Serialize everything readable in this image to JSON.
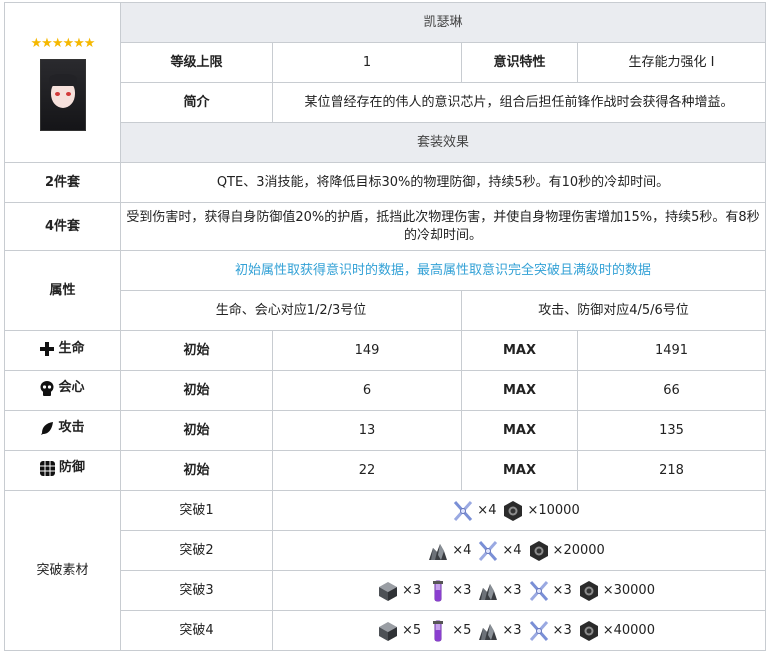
{
  "header": {
    "stars": "★★★★★★",
    "name": "凯瑟琳",
    "level_cap_label": "等级上限",
    "level_cap_value": "1",
    "trait_label": "意识特性",
    "trait_value": "生存能力强化 I",
    "intro_label": "简介",
    "intro_value": "某位曾经存在的伟人的意识芯片，组合后担任前锋作战时会获得各种增益。"
  },
  "set": {
    "title": "套装效果",
    "two_label": "2件套",
    "two_text": "QTE、3消技能，将降低目标30%的物理防御，持续5秒。有10秒的冷却时间。",
    "four_label": "4件套",
    "four_text": "受到伤害时，获得自身防御值20%的护盾，抵挡此次物理伤害，并使自身物理伤害增加15%，持续5秒。有8秒的冷却时间。"
  },
  "attributes": {
    "label": "属性",
    "note": "初始属性取获得意识时的数据，最高属性取意识完全突破且满级时的数据",
    "group_a": "生命、会心对应1/2/3号位",
    "group_b": "攻击、防御对应4/5/6号位",
    "initial_label": "初始",
    "max_label": "MAX",
    "rows": [
      {
        "name": "生命",
        "icon": "plus-icon",
        "initial": "149",
        "max": "1491"
      },
      {
        "name": "会心",
        "icon": "skull-icon",
        "initial": "6",
        "max": "66"
      },
      {
        "name": "攻击",
        "icon": "feather-icon",
        "initial": "13",
        "max": "135"
      },
      {
        "name": "防御",
        "icon": "shield-grid-icon",
        "initial": "22",
        "max": "218"
      }
    ]
  },
  "breakthrough": {
    "label": "突破素材",
    "rows": [
      {
        "name": "突破1",
        "items": [
          {
            "icon": "tweezer-icon",
            "count": "×4"
          },
          {
            "icon": "nut-icon",
            "count": "×10000"
          }
        ]
      },
      {
        "name": "突破2",
        "items": [
          {
            "icon": "ore-icon",
            "count": "×4"
          },
          {
            "icon": "tweezer-icon",
            "count": "×4"
          },
          {
            "icon": "nut-icon",
            "count": "×20000"
          }
        ]
      },
      {
        "name": "突破3",
        "items": [
          {
            "icon": "cube-icon",
            "count": "×3"
          },
          {
            "icon": "vial-icon",
            "count": "×3"
          },
          {
            "icon": "ore-icon",
            "count": "×3"
          },
          {
            "icon": "tweezer-icon",
            "count": "×3"
          },
          {
            "icon": "nut-icon",
            "count": "×30000"
          }
        ]
      },
      {
        "name": "突破4",
        "items": [
          {
            "icon": "cube-icon",
            "count": "×5"
          },
          {
            "icon": "vial-icon",
            "count": "×5"
          },
          {
            "icon": "ore-icon",
            "count": "×3"
          },
          {
            "icon": "tweezer-icon",
            "count": "×3"
          },
          {
            "icon": "nut-icon",
            "count": "×40000"
          }
        ]
      }
    ]
  },
  "colors": {
    "header_bg": "#eaecf0",
    "note": "#33a1d6",
    "star": "#f5b800",
    "border": "#c8ccd1"
  }
}
